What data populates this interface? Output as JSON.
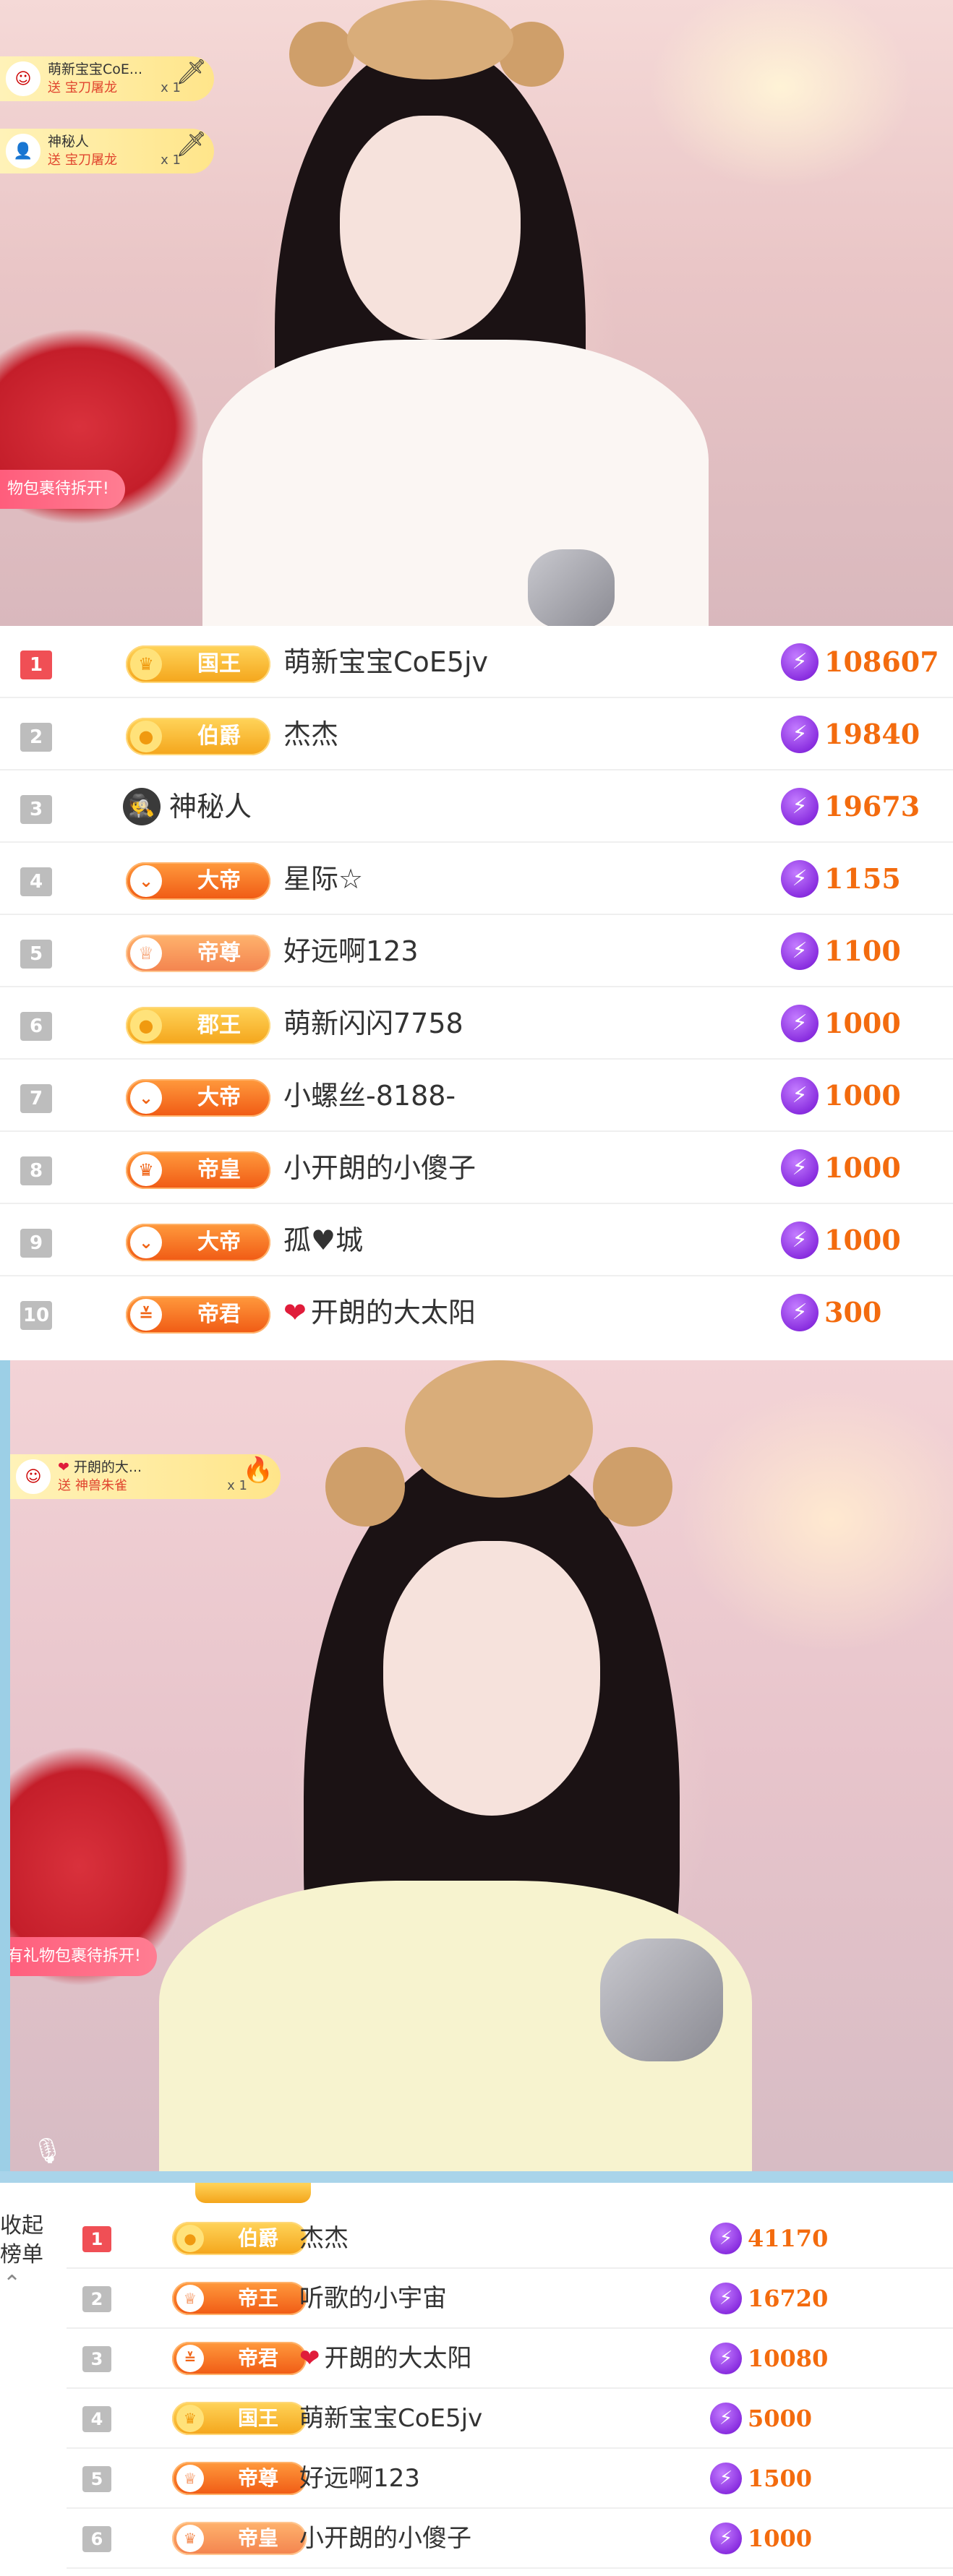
{
  "stream1": {
    "gifts": [
      {
        "user": "萌新宝宝CoE...",
        "send": "送",
        "gift": "宝刀屠龙",
        "count": "x 1"
      },
      {
        "user": "神秘人",
        "send": "送",
        "gift": "宝刀屠龙",
        "count": "x 1"
      }
    ],
    "notice": "物包裹待拆开!"
  },
  "board1": {
    "rows": [
      {
        "rank": "1",
        "badge": "国王",
        "name": "萌新宝宝CoE5jv",
        "score": "108607"
      },
      {
        "rank": "2",
        "badge": "伯爵",
        "name": "杰杰",
        "score": "19840"
      },
      {
        "rank": "3",
        "badge": "",
        "name": "神秘人",
        "score": "19673"
      },
      {
        "rank": "4",
        "badge": "大帝",
        "name": "星际☆",
        "score": "1155"
      },
      {
        "rank": "5",
        "badge": "帝尊",
        "name": "好远啊123",
        "score": "1100"
      },
      {
        "rank": "6",
        "badge": "郡王",
        "name": "萌新闪闪7758",
        "score": "1000"
      },
      {
        "rank": "7",
        "badge": "大帝",
        "name": "小螺丝-8188-",
        "score": "1000"
      },
      {
        "rank": "8",
        "badge": "帝皇",
        "name": "小开朗的小傻子",
        "score": "1000"
      },
      {
        "rank": "9",
        "badge": "大帝",
        "name": "孤♥城",
        "score": "1000"
      },
      {
        "rank": "10",
        "badge": "帝君",
        "name": "开朗的大太阳",
        "score": "300"
      }
    ]
  },
  "stream2": {
    "gift": {
      "user": "开朗的大...",
      "send": "送",
      "gift": "神兽朱雀",
      "count": "x 1"
    },
    "notice": "有礼物包裹待拆开!"
  },
  "board2": {
    "collapse_label": "收起榜单",
    "rows": [
      {
        "rank": "1",
        "badge": "伯爵",
        "name": "杰杰",
        "score": "41170"
      },
      {
        "rank": "2",
        "badge": "帝王",
        "name": "听歌的小宇宙",
        "score": "16720"
      },
      {
        "rank": "3",
        "badge": "帝君",
        "name": "开朗的大太阳",
        "score": "10080"
      },
      {
        "rank": "4",
        "badge": "国王",
        "name": "萌新宝宝CoE5jv",
        "score": "5000"
      },
      {
        "rank": "5",
        "badge": "帝尊",
        "name": "好远啊123",
        "score": "1500"
      },
      {
        "rank": "6",
        "badge": "帝皇",
        "name": "小开朗的小傻子",
        "score": "1000"
      }
    ]
  },
  "colors": {
    "score": "#f36b0e",
    "rank_top": "#f04f55",
    "rank_other": "#bdbdbd",
    "gold_badge": "#f4a51b",
    "orange_badge": "#f05a14"
  },
  "icons": {
    "score_icon": "lightning-bolt-icon",
    "collapse_icon": "chevron-up-icon",
    "mic_icon": "microphone-icon"
  }
}
